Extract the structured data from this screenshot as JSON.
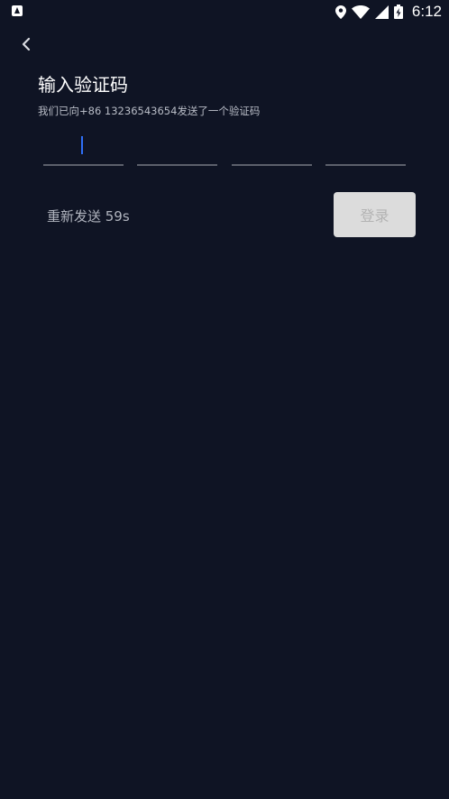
{
  "status_bar": {
    "time": "6:12",
    "icons": [
      "app-notification-icon",
      "location-icon",
      "wifi-icon",
      "signal-icon",
      "battery-icon"
    ]
  },
  "header": {
    "back_icon": "chevron-left-icon"
  },
  "main": {
    "title": "输入验证码",
    "subtitle": "我们已向+86 13236543654发送了一个验证码",
    "code_inputs": [
      "",
      "",
      "",
      ""
    ],
    "resend_label": "重新发送 59s",
    "login_label": "登录"
  },
  "colors": {
    "background": "#0f1424",
    "caret": "#2f6ff7",
    "underline": "#5c606b",
    "login_disabled_bg": "#dcdcdc",
    "login_disabled_text": "#b3b3b3"
  }
}
